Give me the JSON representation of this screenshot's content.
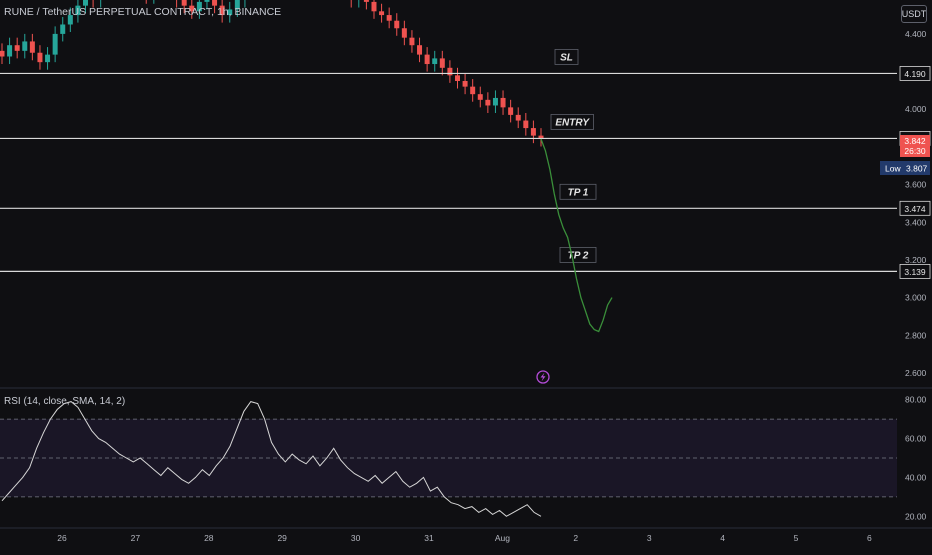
{
  "header": {
    "title": "RUNE / TetherUS PERPETUAL CONTRACT, 1h, BINANCE"
  },
  "currency": "USDT",
  "rsi_header": "RSI (14, close, SMA, 14, 2)",
  "colors": {
    "background": "#0f0f12",
    "up": "#26a69a",
    "down": "#ef5350",
    "hline": "#d9d9d9",
    "path": "#3a8f3a",
    "rsi_line": "#d6d6d6",
    "rsi_band": "#1a1626",
    "axis_text": "#b2b5be",
    "price_tag_bg": "#ef5350",
    "low_tag_bg": "#223a6b"
  },
  "chart_data": [
    {
      "type": "line",
      "name": "price",
      "yaxis_ticks": [
        "4.400",
        "4.200",
        "4.000",
        "3.800",
        "3.600",
        "3.400",
        "3.200",
        "3.000",
        "2.800",
        "2.600"
      ],
      "ylim": [
        2.52,
        4.58
      ],
      "xaxis_ticks": [
        "26",
        "27",
        "28",
        "29",
        "30",
        "31",
        "Aug",
        "2",
        "3",
        "4",
        "5",
        "6"
      ],
      "levels": [
        {
          "label": "SL",
          "value": 4.19,
          "tag": "4.190"
        },
        {
          "label": "ENTRY",
          "value": 3.845,
          "tag": "3.845"
        },
        {
          "label": "TP 1",
          "value": 3.474,
          "tag": "3.474"
        },
        {
          "label": "TP 2",
          "value": 3.139,
          "tag": "3.139"
        }
      ],
      "current_price": {
        "value": "3.842",
        "countdown": "26:30"
      },
      "low": {
        "label": "Low",
        "value": "3.807"
      },
      "closes": [
        4.28,
        4.34,
        4.31,
        4.36,
        4.3,
        4.25,
        4.29,
        4.4,
        4.45,
        4.5,
        4.55,
        4.62,
        4.58,
        4.66,
        4.7,
        4.73,
        4.68,
        4.72,
        4.65,
        4.6,
        4.62,
        4.68,
        4.64,
        4.58,
        4.55,
        4.52,
        4.57,
        4.6,
        4.55,
        4.5,
        4.53,
        4.58,
        4.62,
        4.66,
        4.7,
        4.68,
        4.73,
        4.78,
        4.82,
        4.79,
        4.75,
        4.8,
        4.74,
        4.7,
        4.66,
        4.62,
        4.58,
        4.61,
        4.57,
        4.52,
        4.5,
        4.47,
        4.43,
        4.38,
        4.34,
        4.29,
        4.24,
        4.27,
        4.22,
        4.18,
        4.15,
        4.12,
        4.08,
        4.05,
        4.02,
        4.06,
        4.01,
        3.97,
        3.94,
        3.9,
        3.86,
        3.842
      ],
      "projection": [
        3.842,
        3.78,
        3.68,
        3.55,
        3.44,
        3.37,
        3.32,
        3.22,
        3.1,
        3.0,
        2.93,
        2.86,
        2.83,
        2.82,
        2.88,
        2.96,
        3.0
      ]
    },
    {
      "type": "line",
      "name": "RSI",
      "yaxis_ticks": [
        "80.00",
        "60.00",
        "40.00",
        "20.00"
      ],
      "ylim": [
        14,
        86
      ],
      "bands": [
        70,
        50,
        30
      ],
      "values": [
        28,
        32,
        36,
        40,
        45,
        55,
        63,
        70,
        75,
        78,
        79,
        76,
        70,
        64,
        60,
        58,
        55,
        52,
        50,
        48,
        50,
        47,
        44,
        41,
        45,
        42,
        39,
        37,
        40,
        44,
        41,
        46,
        50,
        56,
        65,
        74,
        79,
        78,
        70,
        58,
        52,
        48,
        52,
        49,
        47,
        51,
        46,
        50,
        55,
        49,
        45,
        42,
        40,
        38,
        41,
        37,
        40,
        43,
        38,
        35,
        37,
        40,
        33,
        35,
        30,
        27,
        26,
        24,
        25,
        22,
        24,
        21,
        23,
        20,
        22,
        24,
        26,
        22,
        20
      ]
    }
  ]
}
